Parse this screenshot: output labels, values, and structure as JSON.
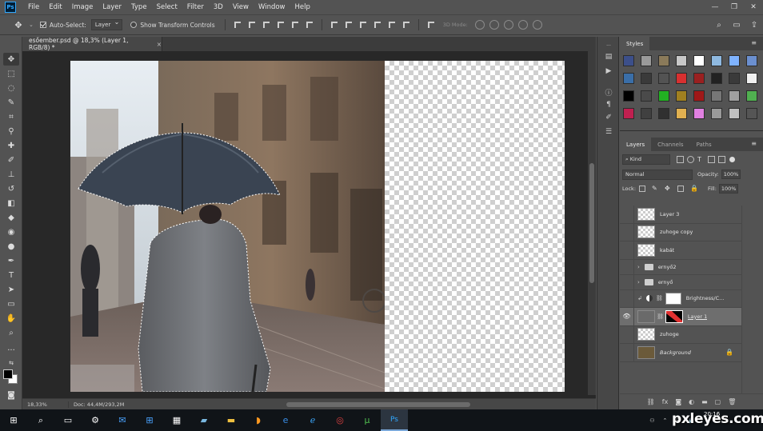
{
  "app": {
    "logo": "Ps"
  },
  "menu": [
    "File",
    "Edit",
    "Image",
    "Layer",
    "Type",
    "Select",
    "Filter",
    "3D",
    "View",
    "Window",
    "Help"
  ],
  "window_controls": {
    "minimize": "—",
    "restore": "❐",
    "close": "✕"
  },
  "options": {
    "auto_select_label": "Auto-Select:",
    "auto_select_value": "Layer",
    "show_transform_label": "Show Transform Controls",
    "mode_3d_label": "3D Mode:"
  },
  "document": {
    "tab_title": "esőember.psd @ 18,3% (Layer 1, RGB/8) *",
    "tab_close": "×"
  },
  "status": {
    "zoom": "18,33%",
    "doc_size": "Doc: 44,4M/293,2M"
  },
  "styles_panel": {
    "title": "Styles",
    "swatches": [
      "#3c4f8a",
      "#9a9a9a",
      "#8a7a5a",
      "#c8c8c8",
      "#ffffff",
      "#8fb9e0",
      "#7fb3ff",
      "#6b8fcf",
      "#3a6ea8",
      "#3a3a3a",
      "#535353",
      "#d83030",
      "#9a2020",
      "#222222",
      "#3a3a3a",
      "#f0f0f0",
      "#000000",
      "#4a4a4a",
      "#22b022",
      "#a08020",
      "#a01818",
      "#777777",
      "#a0a0a0",
      "#50b050",
      "#c02050",
      "#404040",
      "#303030",
      "#e0b050",
      "#e080e0",
      "#999999",
      "#c0c0c0",
      "#555555"
    ]
  },
  "layers_panel": {
    "tabs": [
      "Layers",
      "Channels",
      "Paths"
    ],
    "kind": "Kind",
    "blend_mode": "Normal",
    "opacity_label": "Opacity:",
    "opacity_value": "100%",
    "lock_label": "Lock:",
    "fill_label": "Fill:",
    "fill_value": "100%",
    "layers": [
      {
        "name": "Layer 3",
        "type": "pixel",
        "visible": false,
        "selected": false
      },
      {
        "name": "zuhoge copy",
        "type": "pixel",
        "visible": false,
        "selected": false
      },
      {
        "name": "kabát",
        "type": "pixel",
        "visible": false,
        "selected": false
      },
      {
        "name": "ernyő2",
        "type": "group",
        "visible": false,
        "selected": false
      },
      {
        "name": "ernyő",
        "type": "group",
        "visible": false,
        "selected": false
      },
      {
        "name": "Brightness/C...",
        "type": "adjustment",
        "visible": false,
        "selected": false
      },
      {
        "name": "Layer 1",
        "type": "pixel-mask",
        "visible": true,
        "selected": true
      },
      {
        "name": "zuhoge",
        "type": "pixel",
        "visible": false,
        "selected": false
      },
      {
        "name": "Background",
        "type": "background",
        "visible": false,
        "selected": false
      }
    ],
    "bottom_icons": [
      "link-icon",
      "fx-icon",
      "mask-icon",
      "adjustment-icon",
      "folder-icon",
      "new-layer-icon",
      "trash-icon"
    ]
  },
  "taskbar": {
    "time": "20:16",
    "icons": [
      "windows-start-icon",
      "search-icon",
      "task-view-icon",
      "settings-icon",
      "mail-icon",
      "store-icon",
      "calculator-icon",
      "note-icon",
      "file-explorer-icon",
      "uc-browser-icon",
      "edge-icon",
      "internet-explorer-icon",
      "chrome-icon",
      "torrent-icon",
      "photoshop-icon"
    ]
  },
  "watermark": "pxleyes.com"
}
